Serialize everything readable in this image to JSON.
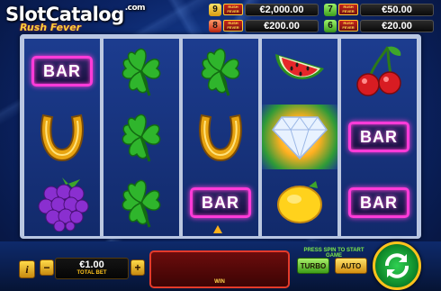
{
  "watermark": {
    "text": "SlotCatalog",
    "suffix": ".com"
  },
  "game_logo": "Rush Fever",
  "colors": {
    "bar_neon": "#ff3bd8",
    "win_border": "#e43a2a",
    "spin_green": "#108d2c",
    "gold": "#ffc31c"
  },
  "jackpots": [
    {
      "count": "9",
      "badge": "RUSH FEVER",
      "value": "€2,000.00"
    },
    {
      "count": "7",
      "badge": "RUSH FEVER",
      "value": "€50.00"
    },
    {
      "count": "8",
      "badge": "RUSH FEVER",
      "value": "€200.00"
    },
    {
      "count": "6",
      "badge": "RUSH FEVER",
      "value": "€20.00"
    }
  ],
  "reels": [
    [
      "bar",
      "horseshoe",
      "grapes"
    ],
    [
      "clover",
      "clover",
      "clover"
    ],
    [
      "clover",
      "horseshoe",
      "bar"
    ],
    [
      "watermelon",
      "diamond",
      "lemon"
    ],
    [
      "cherries",
      "bar",
      "bar"
    ]
  ],
  "symbols": {
    "bar": "BAR"
  },
  "controls": {
    "info_label": "i",
    "minus_label": "−",
    "plus_label": "+",
    "bet_value": "€1.00",
    "bet_label": "TOTAL BET",
    "win_label": "WIN",
    "start_message": "PRESS SPIN TO START GAME",
    "turbo_label": "TURBO",
    "auto_label": "AUTO",
    "spin_icon": "spin-arrows-icon"
  }
}
